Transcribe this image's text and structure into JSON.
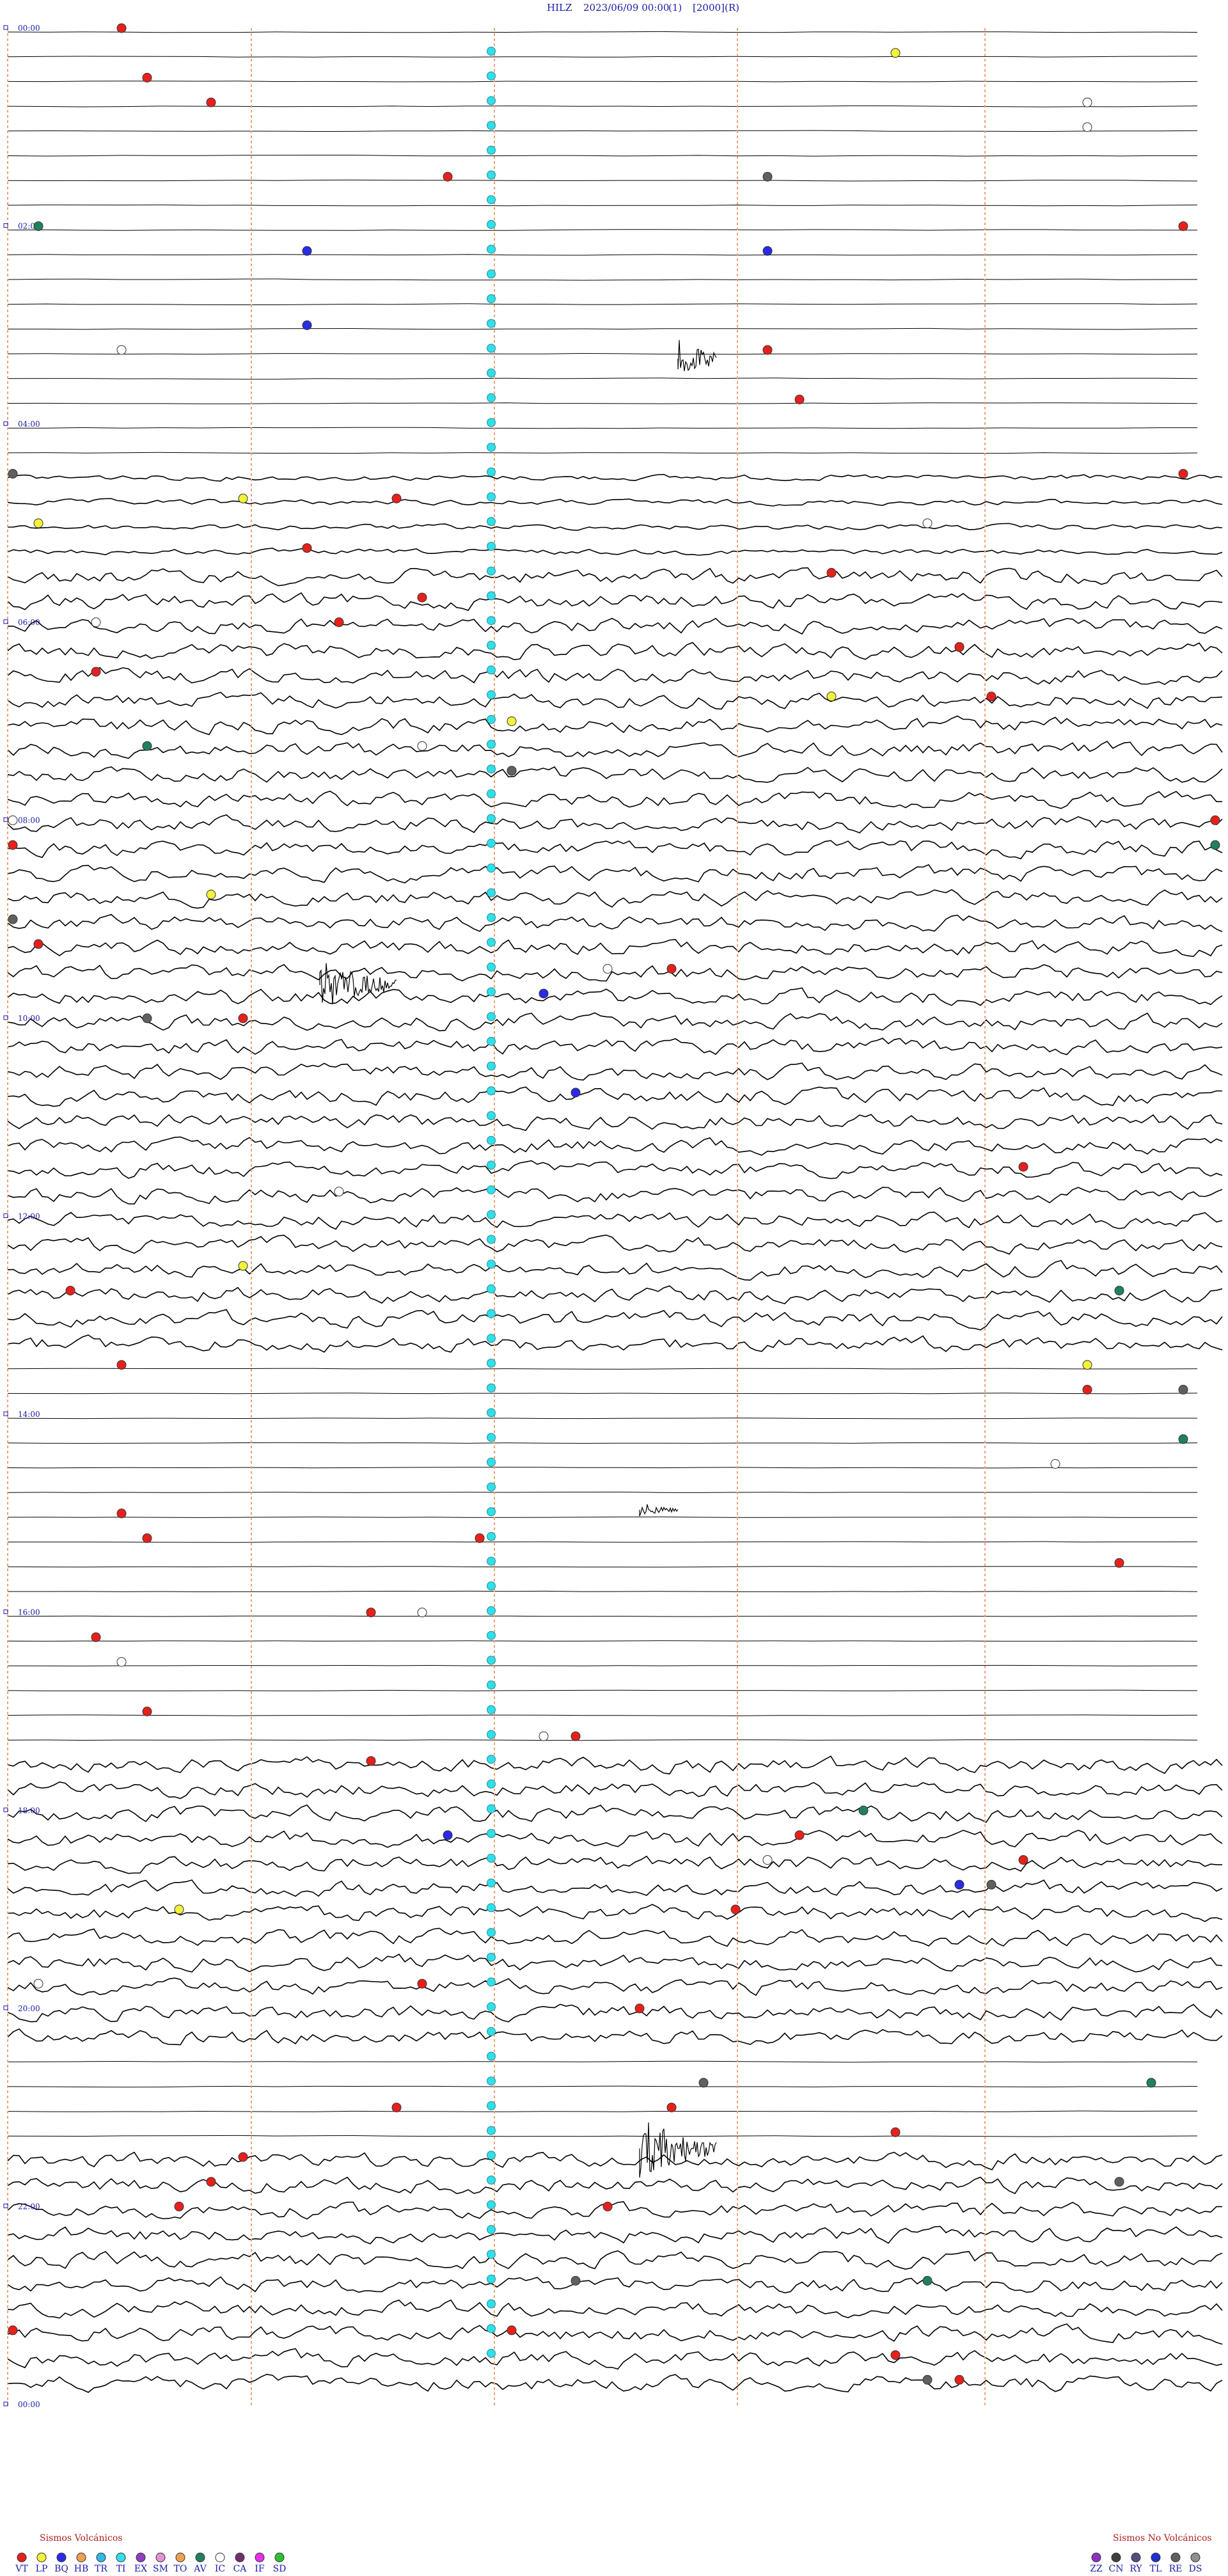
{
  "header": {
    "station": "HILZ",
    "datetime": "2023/06/09 00:00",
    "filter": "(1)",
    "scale": "[2000]",
    "mode": "(R)"
  },
  "chart_data": {
    "type": "helicorder",
    "rows_per_hour": 4,
    "hour_labels": [
      "00:00",
      "02:00",
      "04:00",
      "06:00",
      "08:00",
      "10:00",
      "12:00",
      "14:00",
      "16:00",
      "18:00",
      "20:00",
      "22:00",
      "00:00"
    ],
    "colors": {
      "trace": "#000000",
      "hour_label": "#1a1aa8",
      "marker_line": "#f2a070",
      "VT": "#e8201c",
      "LP": "#f2f23a",
      "BQ": "#2a2ae8",
      "HB": "#f0a050",
      "TR": "#30b8e8",
      "TI": "#30e0e8",
      "EX": "#9040c0",
      "SM": "#e890d0",
      "TO": "#f0a050",
      "AV": "#208060",
      "IC": "#ffffff",
      "CA": "#703070",
      "IF": "#e830e8",
      "SD": "#30c030",
      "ZZ": "#9030c0",
      "CN": "#404040",
      "RY": "#505080",
      "TL": "#2030d0",
      "RE": "#606060",
      "DS": "#909090"
    },
    "legend_volcanic": {
      "title": "Sismos Volcánicos",
      "codes": [
        "VT",
        "LP",
        "BQ",
        "HB",
        "TR",
        "TI",
        "EX",
        "SM",
        "TO",
        "AV",
        "IC",
        "CA",
        "IF",
        "SD"
      ]
    },
    "legend_nonvolcanic": {
      "title": "Sismos No Volcánicos",
      "codes": [
        "ZZ",
        "CN",
        "RY",
        "TL",
        "RE",
        "DS"
      ]
    }
  }
}
